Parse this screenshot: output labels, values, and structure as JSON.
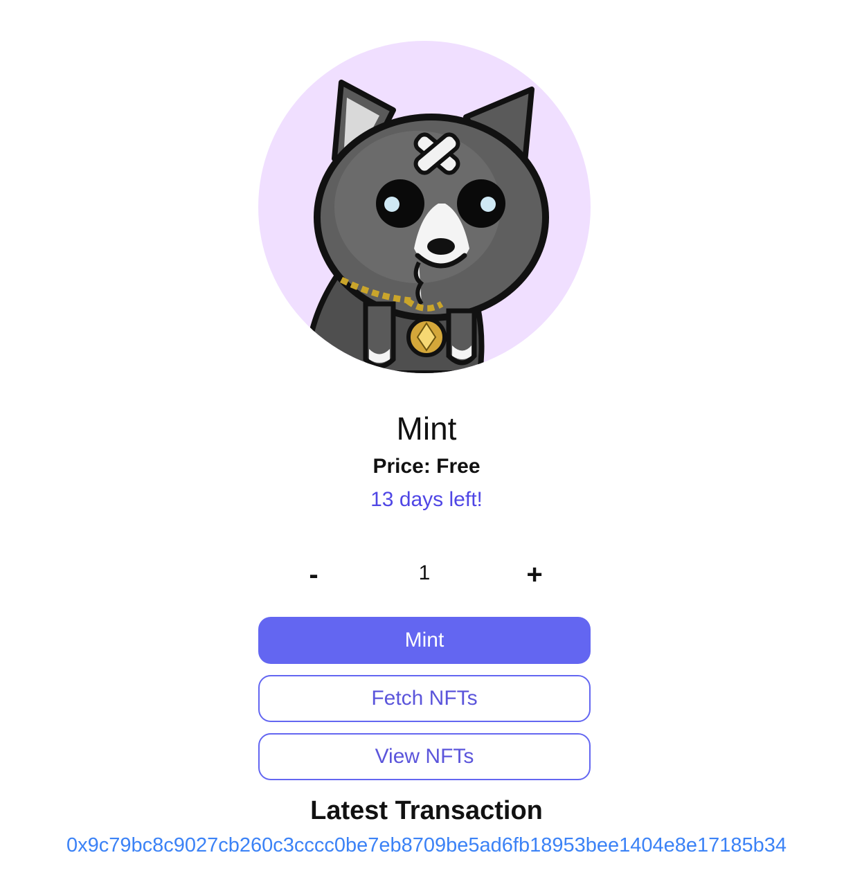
{
  "nft": {
    "image_icon": "cat-nft-avatar",
    "background_color": "#f0dfff"
  },
  "mint_section": {
    "title": "Mint",
    "price": "Price: Free",
    "countdown": "13 days left!"
  },
  "quantity": {
    "decrement_label": "-",
    "value": "1",
    "increment_label": "+"
  },
  "buttons": {
    "mint_label": "Mint",
    "fetch_label": "Fetch NFTs",
    "view_label": "View NFTs"
  },
  "latest_transaction": {
    "heading": "Latest Transaction",
    "hash": "0x9c79bc8c9027cb260c3cccc0be7eb8709be5ad6fb18953bee1404e8e17185b34"
  },
  "colors": {
    "accent": "#6366f1",
    "countdown": "#4f46e5",
    "link": "#3b82f6"
  }
}
